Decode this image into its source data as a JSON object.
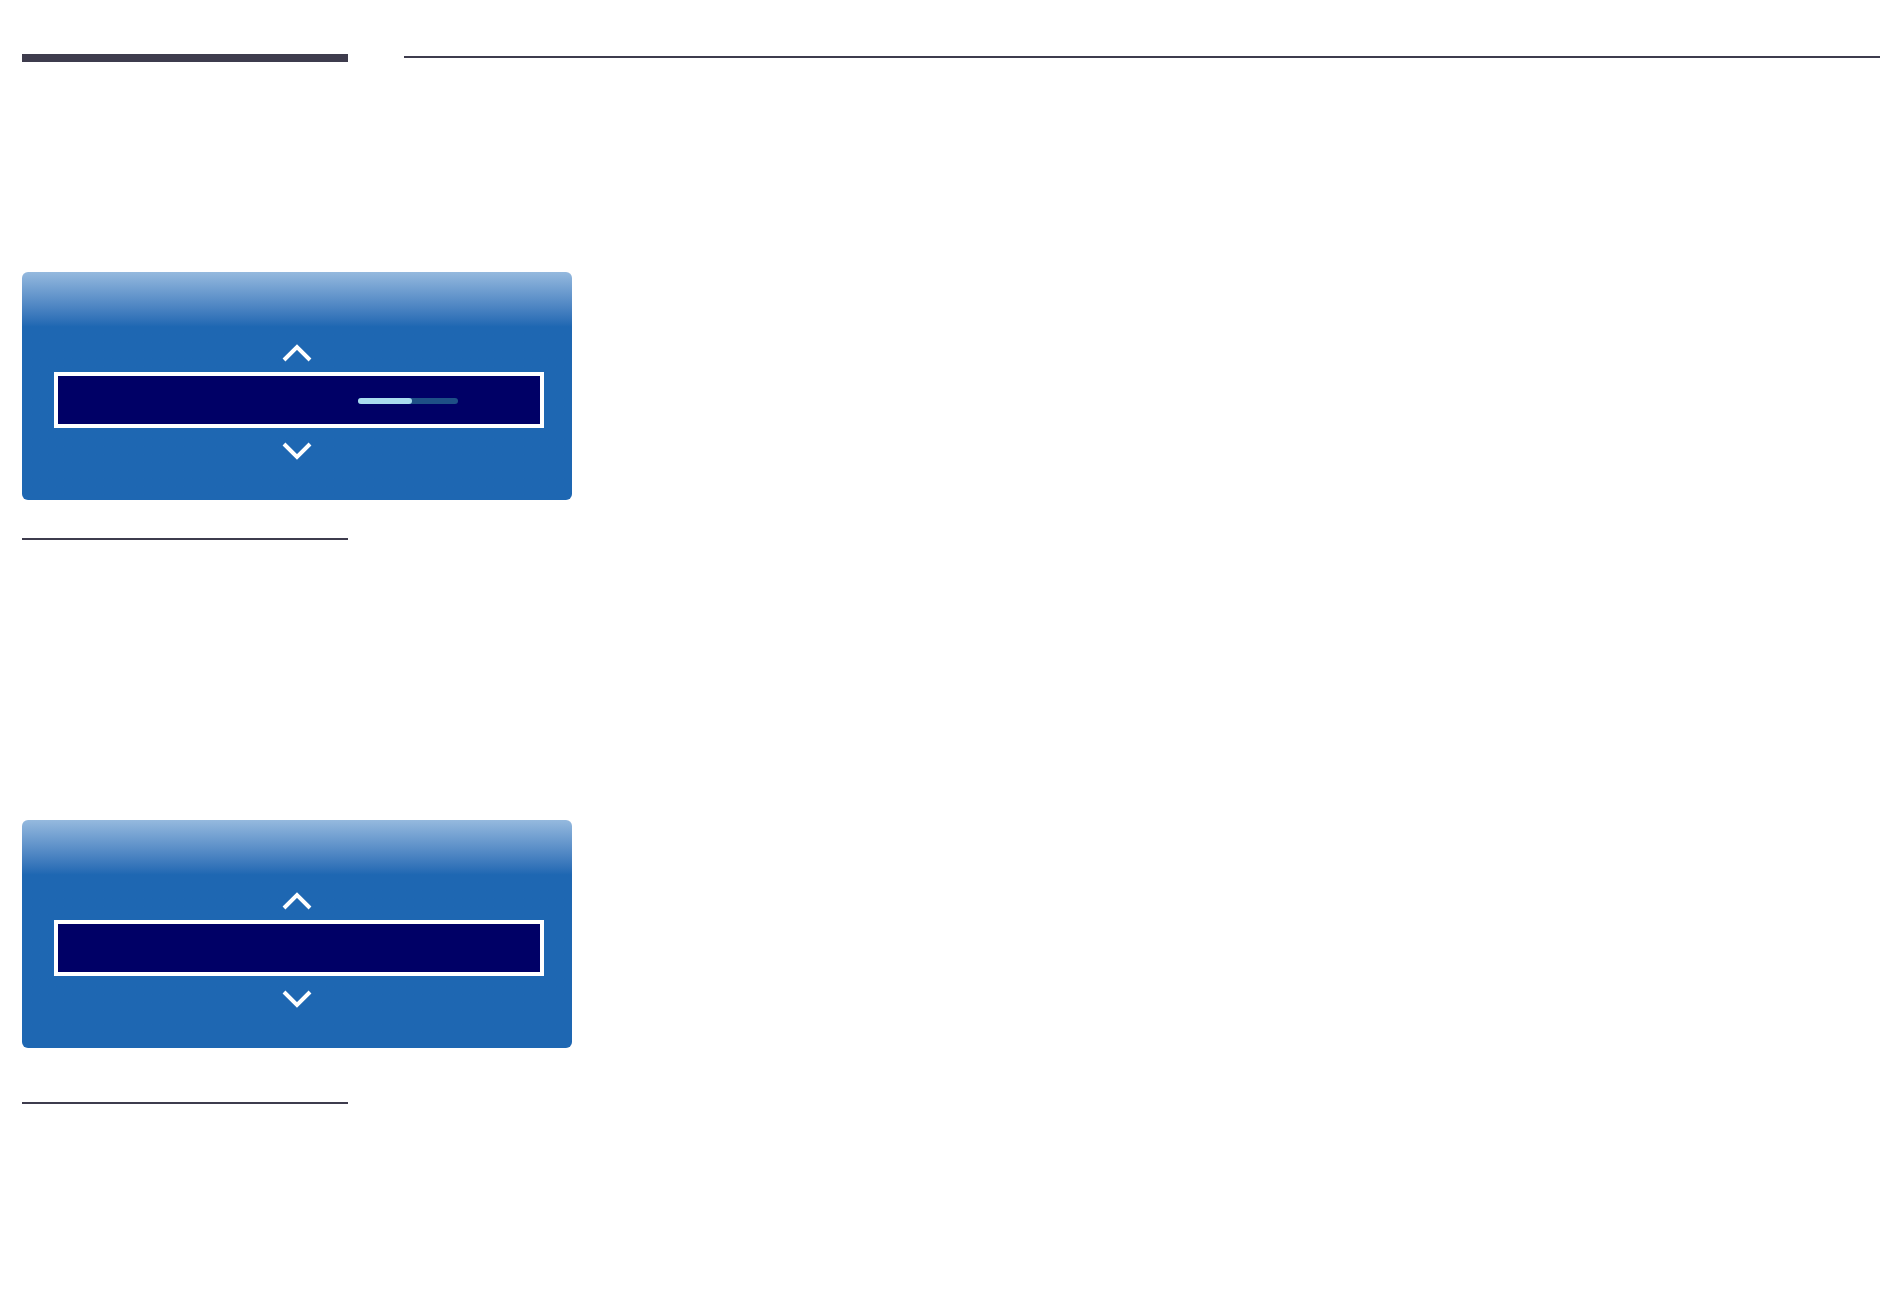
{
  "panels": [
    {
      "kind": "slider",
      "level": 0.54
    },
    {
      "kind": "plain"
    }
  ]
}
